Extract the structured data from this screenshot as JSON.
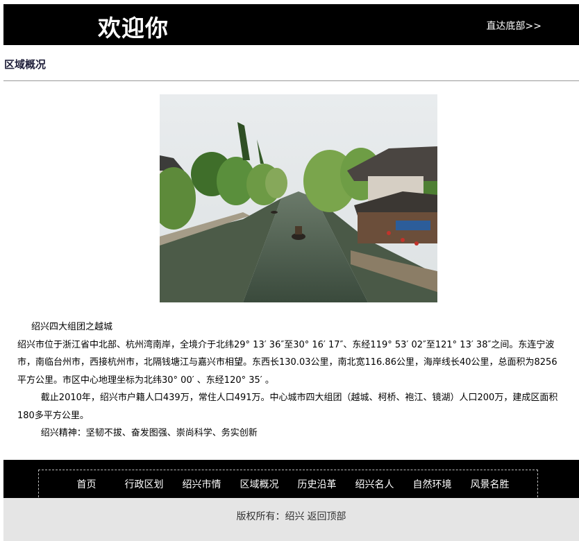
{
  "header": {
    "logo_text": "欢迎你",
    "to_bottom_link": "直达底部>>"
  },
  "section": {
    "title": "区域概况"
  },
  "content": {
    "subtitle": "绍兴四大组团之越城",
    "paragraph1": "绍兴市位于浙江省中北部、杭州湾南岸，全境介于北纬29° 13′ 36″至30° 16′ 17″、东经119° 53′  02″至121° 13′ 38″之间。东连宁波市，南临台州市，西接杭州市，北隔钱塘江与嘉兴市相望。东西长130.03公里，南北宽116.86公里，海岸线长40公里，总面积为8256平方公里。市区中心地理坐标为北纬30° 00′ 、东经120° 35′ 。",
    "paragraph2": "截止2010年，绍兴市户籍人口439万，常住人口491万。中心城市四大组团（越城、柯桥、袍江、镜湖）人口200万，建成区面积180多平方公里。",
    "paragraph3": "绍兴精神：坚韧不拔、奋发图强、崇尚科学、务实创新"
  },
  "nav": {
    "items": [
      "首页",
      "行政区划",
      "绍兴市情",
      "区域概况",
      "历史沿革",
      "绍兴名人",
      "自然环境",
      "风景名胜"
    ]
  },
  "footer": {
    "copyright": "版权所有：绍兴",
    "back_to_top": "返回顶部"
  }
}
